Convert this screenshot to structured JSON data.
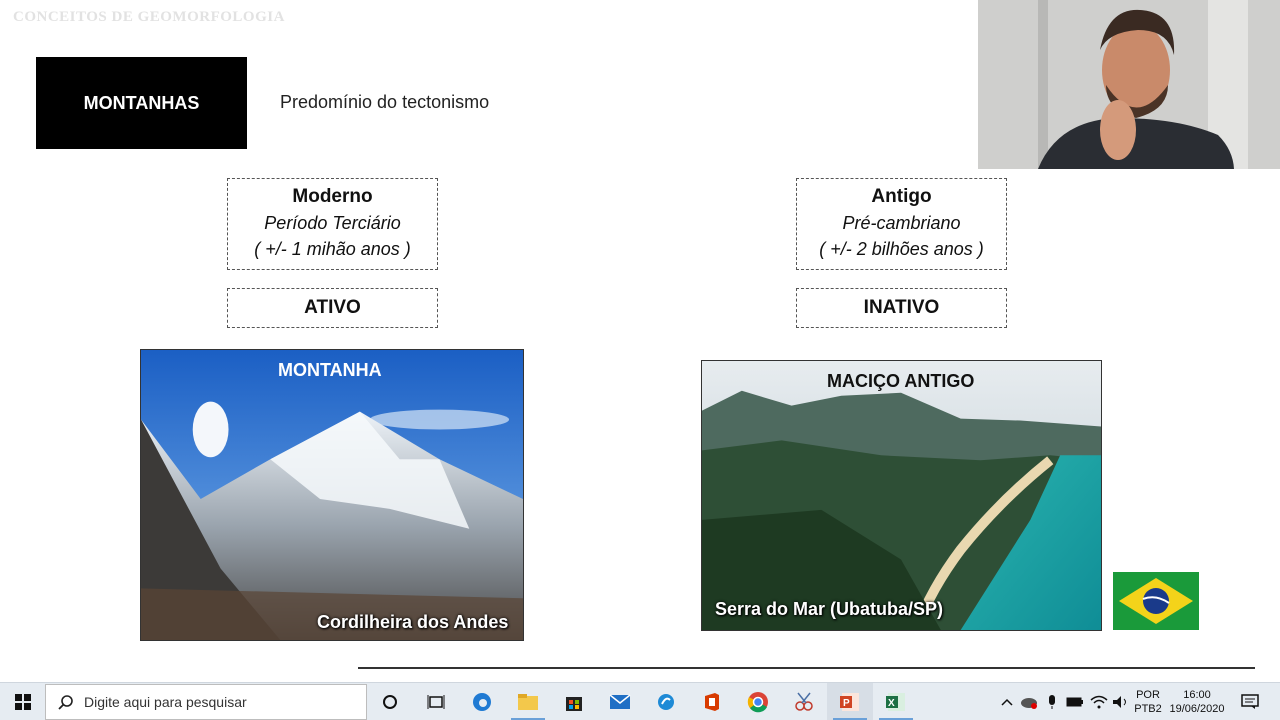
{
  "slide": {
    "watermark": "CONCEITOS DE GEOMORFOLOGIA",
    "title": "MONTANHAS",
    "subtitle": "Predomínio do tectonismo",
    "left": {
      "heading": "Moderno",
      "line1": "Período Terciário",
      "line2": "( +/-  1 mihão anos )",
      "status": "ATIVO",
      "photo_title": "MONTANHA",
      "photo_caption": "Cordilheira dos Andes"
    },
    "right": {
      "heading": "Antigo",
      "line1": "Pré-cambriano",
      "line2": "( +/-  2 bilhões anos )",
      "status": "INATIVO",
      "photo_title": "MACIÇO ANTIGO",
      "photo_caption": "Serra do Mar (Ubatuba/SP)"
    }
  },
  "taskbar": {
    "search_placeholder": "Digite aqui para pesquisar",
    "language_top": "POR",
    "language_bottom": "PTB2",
    "time": "16:00",
    "date": "19/06/2020",
    "apps": [
      "windows-start-icon",
      "cortana-icon",
      "task-view-icon",
      "edge-icon",
      "file-explorer-icon",
      "store-icon",
      "mail-icon",
      "app-blue-icon",
      "office-icon",
      "chrome-icon",
      "snipping-icon",
      "powerpoint-icon",
      "excel-icon"
    ]
  },
  "colors": {
    "title_bg": "#000000",
    "taskbar_bg": "#e6ecf2",
    "sea": "#1aa6a6",
    "sky": "#2f7fd6"
  }
}
